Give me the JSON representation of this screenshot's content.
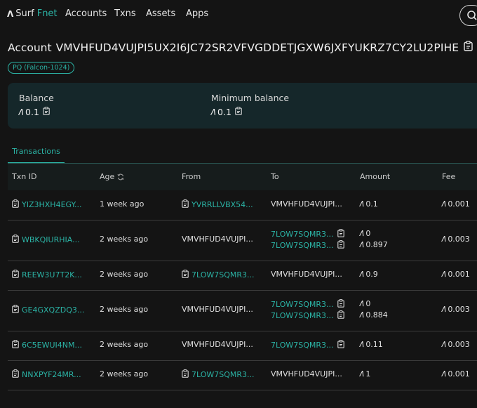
{
  "nav": {
    "brand_prefix": "Surf",
    "brand_suffix": "Fnet",
    "links": [
      "Accounts",
      "Txns",
      "Assets",
      "Apps"
    ]
  },
  "account": {
    "label": "Account",
    "address": "VMVHFUD4VUJPI5UX2I6JC72SR2VFVGDDETJGXW6JXFYUKRZ7CY2LU2PIHE",
    "badge": "PQ (Falcon-1024)"
  },
  "balance": {
    "balance_label": "Balance",
    "balance_value": "0.1",
    "min_label": "Minimum balance",
    "min_value": "0.1"
  },
  "tab": {
    "label": "Transactions"
  },
  "table": {
    "headers": {
      "txn_id": "Txn ID",
      "age": "Age",
      "from": "From",
      "to": "To",
      "amount": "Amount",
      "fee": "Fee"
    },
    "rows": [
      {
        "txn": "YIZ3HXH4EGY...",
        "age": "1 week ago",
        "from": "YVRRLLVBX54...",
        "to": [
          "VMVHFUD4VUJPI..."
        ],
        "amounts": [
          "0.1"
        ],
        "fee": "0.001"
      },
      {
        "txn": "WBKQIURHIA...",
        "age": "2 weeks ago",
        "from": "VMVHFUD4VUJPI...",
        "to": [
          "7LOW7SQMR3...",
          "7LOW7SQMR3..."
        ],
        "amounts": [
          "0",
          "0.897"
        ],
        "fee": "0.003"
      },
      {
        "txn": "REEW3U7T2K...",
        "age": "2 weeks ago",
        "from": "7LOW7SQMR3...",
        "to": [
          "VMVHFUD4VUJPI..."
        ],
        "amounts": [
          "0.9"
        ],
        "fee": "0.001"
      },
      {
        "txn": "GE4GXQZDQ3...",
        "age": "2 weeks ago",
        "from": "VMVHFUD4VUJPI...",
        "to": [
          "7LOW7SQMR3...",
          "7LOW7SQMR3..."
        ],
        "amounts": [
          "0",
          "0.884"
        ],
        "fee": "0.003"
      },
      {
        "txn": "6C5EWUI4NM...",
        "age": "2 weeks ago",
        "from": "VMVHFUD4VUJPI...",
        "to": [
          "7LOW7SQMR3..."
        ],
        "amounts": [
          "0.11"
        ],
        "fee": "0.003"
      },
      {
        "txn": "NNXPYF24MR...",
        "age": "2 weeks ago",
        "from": "7LOW7SQMR3...",
        "to": [
          "VMVHFUD4VUJPI..."
        ],
        "amounts": [
          "1"
        ],
        "fee": "0.001"
      }
    ]
  },
  "colors": {
    "accent": "#2bb3a5",
    "background": "#141414",
    "card": "#15272a"
  }
}
